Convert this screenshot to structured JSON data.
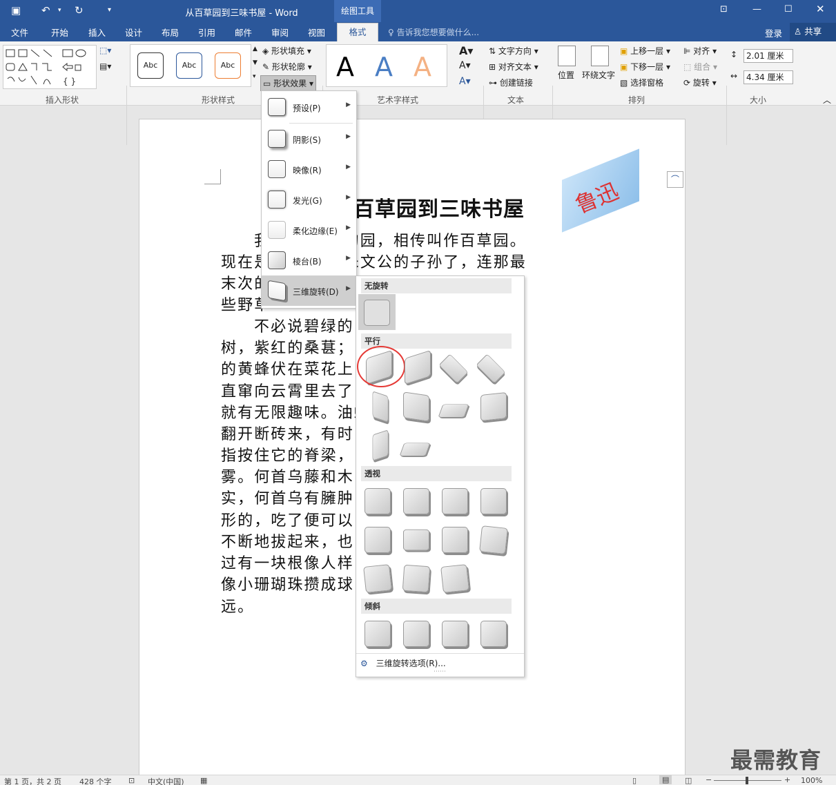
{
  "window": {
    "title": "从百草园到三味书屋 - Word",
    "context_tab_label": "绘图工具"
  },
  "tabs": [
    "文件",
    "开始",
    "插入",
    "设计",
    "布局",
    "引用",
    "邮件",
    "审阅",
    "视图",
    "格式"
  ],
  "active_tab": "格式",
  "tell_me": "告诉我您想要做什么...",
  "account": {
    "login": "登录",
    "share": "共享"
  },
  "ribbon": {
    "groups": [
      "插入形状",
      "形状样式",
      "艺术字样式",
      "文本",
      "排列",
      "大小"
    ],
    "shape_style_samples": [
      "Abc",
      "Abc",
      "Abc"
    ],
    "shape_fill": "形状填充",
    "shape_outline": "形状轮廓",
    "shape_effects": "形状效果",
    "wordart_letters": [
      "A",
      "A",
      "A"
    ],
    "text": {
      "direction": "文字方向",
      "align": "对齐文本",
      "link": "创建链接"
    },
    "arrange": {
      "position": "位置",
      "wrap": "环绕文字",
      "forward": "上移一层",
      "backward": "下移一层",
      "pane": "选择窗格",
      "align": "对齐",
      "group": "组合",
      "rotate": "旋转"
    },
    "size": {
      "height": "2.01 厘米",
      "width": "4.34 厘米"
    }
  },
  "document": {
    "title": "百草园到三味书屋",
    "shape_text": "鲁迅",
    "lines": [
      "我                     一个很大的园，相传叫作百草园。",
      "现在是                     一起卖给朱文公的子孙了，连那最",
      "末次的                                               确凿只有一",
      "些野草",
      "不必说碧绿的                                  高大的皂荚",
      "树，紫红的桑葚；                          长吟，肥胖",
      "的黄蜂伏在菜花上                      忽然从草间",
      "直窜向云霄里去了                      墙根一带，",
      "就有无限趣味。油蛉                      这里弹琴。",
      "翻开断砖来，有时                          倘若用手",
      "指按住它的脊梁，                          喷出一阵烟",
      "雾。何首乌藤和木                          房一般的果",
      "实，何首乌有臃肿                          根是有像人",
      "形的，吃了便可以                          起来，牵连",
      "不断地拔起来，也                          从来没有见",
      "过有一块根像人样                          到覆盆子，",
      "像小珊瑚珠攒成球                          桑葚要好得",
      "远。"
    ]
  },
  "effects_menu": {
    "items": [
      "预设(P)",
      "阴影(S)",
      "映像(R)",
      "发光(G)",
      "柔化边缘(E)",
      "棱台(B)",
      "三维旋转(D)"
    ],
    "active": "三维旋转(D)"
  },
  "rotation_gallery": {
    "sections": [
      "无旋转",
      "平行",
      "透视",
      "倾斜"
    ],
    "options_label": "三维旋转选项(R)..."
  },
  "status_bar": {
    "page": "第 1 页，共 2 页",
    "words": "428 个字",
    "language": "中文(中国)",
    "zoom": "100%"
  },
  "watermark": "最需教育"
}
